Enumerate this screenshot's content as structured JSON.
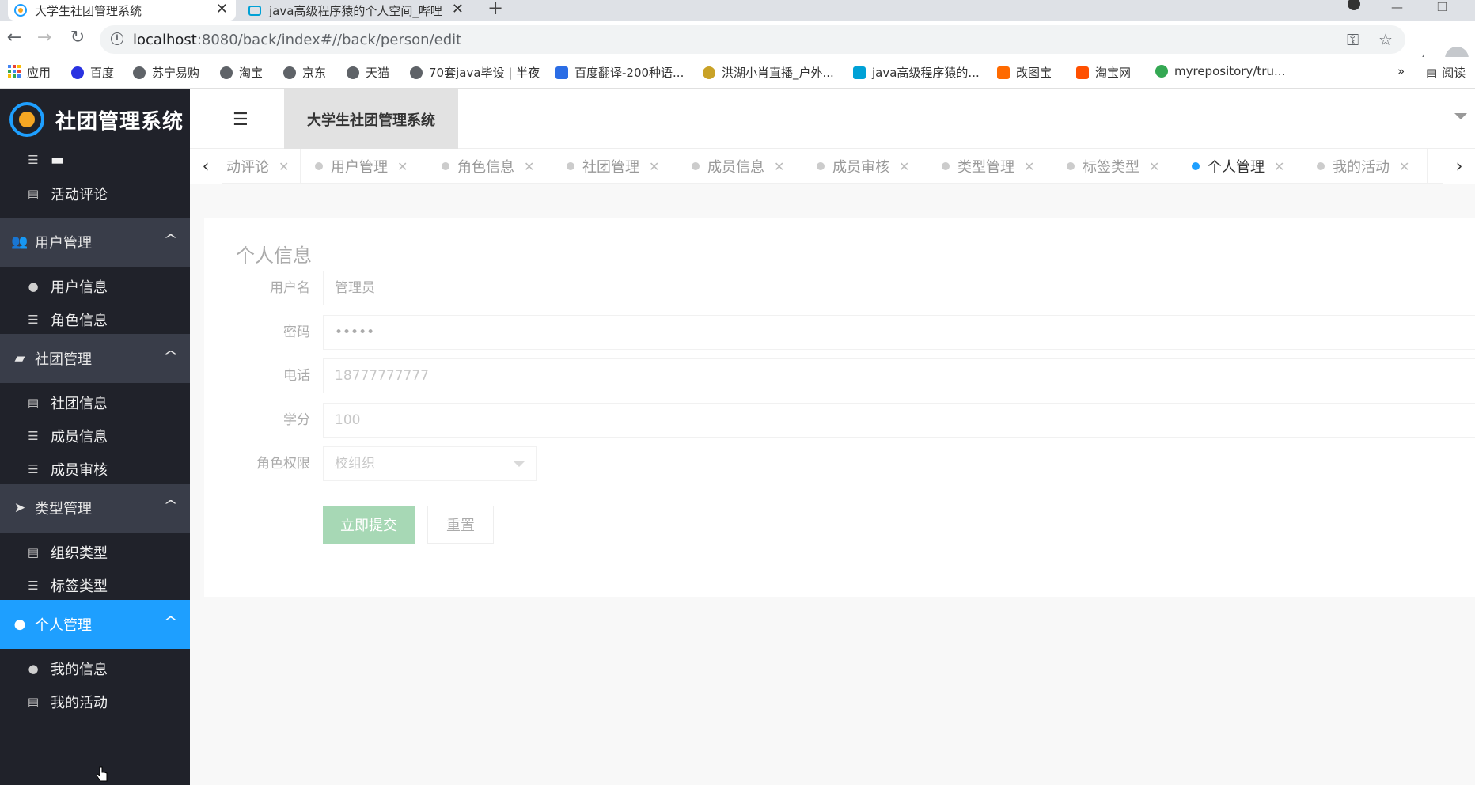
{
  "browser": {
    "tabs": [
      {
        "title": "大学生社团管理系统",
        "active": true
      },
      {
        "title": "java高级程序猿的个人空间_哔哩",
        "active": false
      }
    ],
    "url_host": "localhost",
    "url_rest": ":8080/back/index#//back/person/edit",
    "bookmarks": [
      "应用",
      "百度",
      "苏宁易购",
      "淘宝",
      "京东",
      "天猫",
      "70套java毕设 | 半夜",
      "百度翻译-200种语...",
      "洪湖小肖直播_户外...",
      "java高级程序猿的...",
      "改图宝",
      "淘宝网",
      "myrepository/tru..."
    ],
    "bookmarks_more": "»",
    "reading_list": "阅读"
  },
  "app": {
    "logo_text": "社团管理系统",
    "header_title": "大学生社团管理系统",
    "accent": "#1e9fff",
    "sidebar_bg": "#20222a",
    "sidebar": {
      "item_top": "活动评论",
      "groups": [
        {
          "label": "用户管理",
          "icon": "users-icon",
          "items": [
            "用户信息",
            "角色信息"
          ]
        },
        {
          "label": "社团管理",
          "icon": "book-icon",
          "items": [
            "社团信息",
            "成员信息",
            "成员审核"
          ]
        },
        {
          "label": "类型管理",
          "icon": "paper-plane-icon",
          "items": [
            "组织类型",
            "标签类型"
          ]
        },
        {
          "label": "个人管理",
          "icon": "user-icon",
          "items": [
            "我的信息",
            "我的活动"
          ],
          "active": true
        }
      ]
    },
    "page_tabs": [
      {
        "label": "动评论"
      },
      {
        "label": "用户管理"
      },
      {
        "label": "角色信息"
      },
      {
        "label": "社团管理"
      },
      {
        "label": "成员信息"
      },
      {
        "label": "成员审核"
      },
      {
        "label": "类型管理"
      },
      {
        "label": "标签类型"
      },
      {
        "label": "个人管理",
        "active": true
      },
      {
        "label": "我的活动"
      }
    ],
    "form": {
      "legend": "个人信息",
      "username_label": "用户名",
      "username_value": "管理员",
      "password_label": "密码",
      "password_value": "•••••",
      "phone_label": "电话",
      "phone_value": "18777777777",
      "credits_label": "学分",
      "credits_value": "100",
      "role_label": "角色权限",
      "role_value": "校组织",
      "submit_label": "立即提交",
      "reset_label": "重置",
      "submit_color": "#5fb878"
    }
  }
}
